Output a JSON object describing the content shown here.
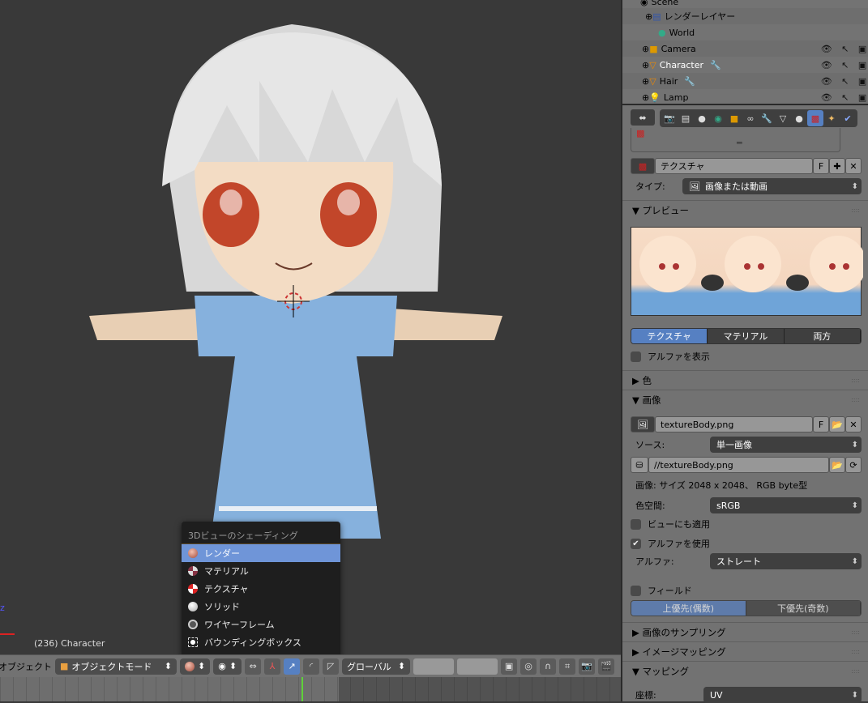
{
  "viewport": {
    "object_label": "(236) Character",
    "axis_z": "z",
    "axis_x": "x"
  },
  "shading_menu": {
    "title": "3Dビューのシェーディング",
    "items": [
      {
        "label": "レンダー",
        "icon": "render-sphere-icon",
        "selected": true
      },
      {
        "label": "マテリアル",
        "icon": "material-sphere-icon",
        "selected": false
      },
      {
        "label": "テクスチャ",
        "icon": "texture-sphere-icon",
        "selected": false
      },
      {
        "label": "ソリッド",
        "icon": "solid-sphere-icon",
        "selected": false
      },
      {
        "label": "ワイヤーフレーム",
        "icon": "wireframe-sphere-icon",
        "selected": false
      },
      {
        "label": "バウンディングボックス",
        "icon": "bounding-box-icon",
        "selected": false
      }
    ]
  },
  "header": {
    "object_menu": "オブジェクト",
    "mode": "オブジェクトモード",
    "orientation": "グローバル"
  },
  "outliner": {
    "items": [
      {
        "name": "Scene"
      },
      {
        "name": "レンダーレイヤー"
      },
      {
        "name": "World"
      },
      {
        "name": "Camera"
      },
      {
        "name": "Character",
        "active": true
      },
      {
        "name": "Hair"
      },
      {
        "name": "Lamp"
      }
    ]
  },
  "properties": {
    "texture_name": "テクスチャ",
    "fake_user": "F",
    "type_label": "タイプ:",
    "type_value": "画像または動画",
    "preview_header": "プレビュー",
    "preview_tabs": [
      "テクスチャ",
      "マテリアル",
      "両方"
    ],
    "show_alpha": "アルファを表示",
    "color_header": "色",
    "image_header": "画像",
    "image_name": "textureBody.png",
    "source_label": "ソース:",
    "source_value": "単一画像",
    "filepath": "//textureBody.png",
    "image_info": "画像: サイズ 2048 x 2048、 RGB byte型",
    "colorspace_label": "色空間:",
    "colorspace_value": "sRGB",
    "view_as_render": "ビューにも適用",
    "use_alpha": "アルファを使用",
    "alpha_label": "アルファ:",
    "alpha_value": "ストレート",
    "fields": "フィールド",
    "field_order": [
      "上優先(偶数)",
      "下優先(奇数)"
    ],
    "sampling_header": "画像のサンプリング",
    "image_mapping_header": "イメージマッピング",
    "mapping_header": "マッピング",
    "coords_label": "座標:",
    "coords_value": "UV"
  },
  "colors": {
    "accent": "#5680c2",
    "selected": "#6f95d8",
    "viewport_bg": "#393939",
    "panel_bg": "#727272"
  }
}
